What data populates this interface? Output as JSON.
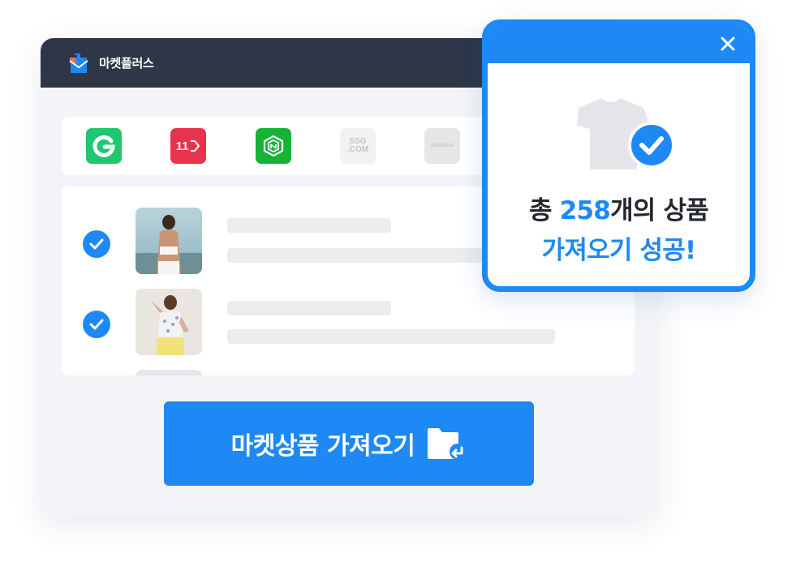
{
  "app": {
    "title": "마켓플러스"
  },
  "markets": [
    {
      "name": "g-market-logo",
      "label": "G"
    },
    {
      "name": "11st-logo",
      "label": "11"
    },
    {
      "name": "naver-smartstore-logo",
      "label": ""
    },
    {
      "name": "ssg-logo",
      "label_line1": "SSG",
      "label_line2": ".COM"
    },
    {
      "name": "musinsa-logo",
      "label": "MUSINSA"
    }
  ],
  "products": [
    {
      "selected": true,
      "image": "woman-in-white-crop-top-photo"
    },
    {
      "selected": true,
      "image": "woman-in-floral-top-photo"
    },
    {
      "selected": false,
      "image": "placeholder"
    }
  ],
  "import_button": {
    "label": "마켓상품 가져오기",
    "icon": "folder-import-icon"
  },
  "success_popup": {
    "count": "258",
    "line1_prefix": "총 ",
    "line1_suffix": "개의 상품",
    "line2": "가져오기 성공!",
    "close_icon": "close-icon",
    "illustration": "tshirt-with-check-icon"
  },
  "colors": {
    "accent": "#1e88f5",
    "titlebar": "#2e3648",
    "background": "#f3f4f7"
  }
}
